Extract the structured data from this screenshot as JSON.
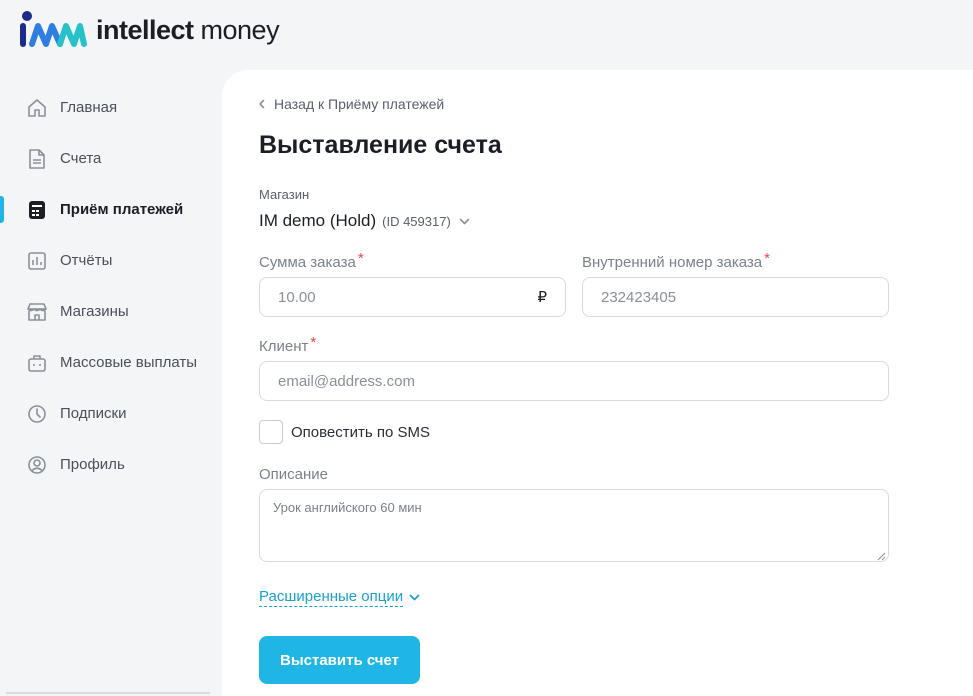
{
  "brand": {
    "name_bold": "intellect",
    "name_light": " money",
    "colors": {
      "navy": "#1c2a8c",
      "blue": "#2f7de0",
      "teal": "#27c2c9",
      "accent": "#1fb6e6"
    }
  },
  "sidebar": {
    "items": [
      {
        "label": "Главная",
        "icon": "home-icon",
        "active": false
      },
      {
        "label": "Счета",
        "icon": "document-icon",
        "active": false
      },
      {
        "label": "Приём платежей",
        "icon": "terminal-icon",
        "active": true
      },
      {
        "label": "Отчёты",
        "icon": "chart-icon",
        "active": false
      },
      {
        "label": "Магазины",
        "icon": "store-icon",
        "active": false
      },
      {
        "label": "Массовые выплаты",
        "icon": "bag-icon",
        "active": false
      },
      {
        "label": "Подписки",
        "icon": "clock-icon",
        "active": false
      },
      {
        "label": "Профиль",
        "icon": "user-icon",
        "active": false
      }
    ]
  },
  "main": {
    "back_link": "Назад к Приёму платежей",
    "title": "Выставление счета",
    "shop": {
      "label": "Магазин",
      "name": "IM demo (Hold)",
      "id_text": "(ID 459317)"
    },
    "amount": {
      "label": "Сумма заказа",
      "required_mark": "*",
      "placeholder": "10.00",
      "currency": "₽"
    },
    "order_number": {
      "label": "Внутренний номер заказа",
      "required_mark": "*",
      "placeholder": "232423405"
    },
    "client": {
      "label": "Клиент",
      "required_mark": "*",
      "placeholder": "email@address.com"
    },
    "sms_checkbox": {
      "label": "Оповестить по SMS",
      "checked": false
    },
    "description": {
      "label": "Описание",
      "placeholder": "Урок английского 60 мин"
    },
    "advanced_options": "Расширенные опции",
    "submit_label": "Выставить счет"
  }
}
